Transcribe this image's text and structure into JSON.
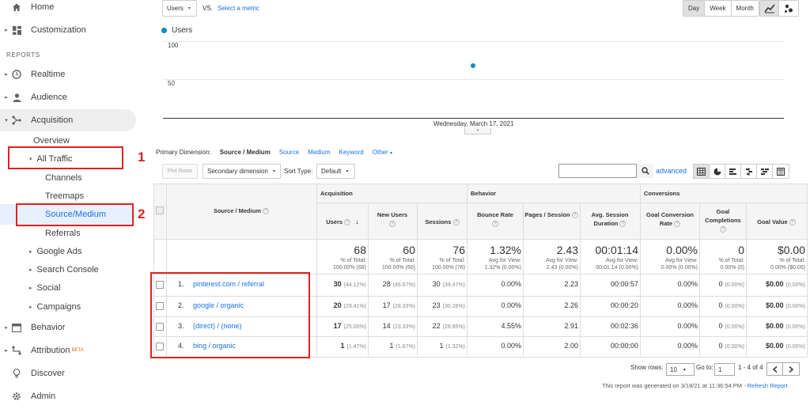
{
  "sidebar": {
    "home": "Home",
    "customization": "Customization",
    "reports_label": "REPORTS",
    "realtime": "Realtime",
    "audience": "Audience",
    "acquisition": "Acquisition",
    "overview": "Overview",
    "all_traffic": "All Traffic",
    "channels": "Channels",
    "treemaps": "Treemaps",
    "source_medium": "Source/Medium",
    "referrals": "Referrals",
    "google_ads": "Google Ads",
    "search_console": "Search Console",
    "social": "Social",
    "campaigns": "Campaigns",
    "behavior": "Behavior",
    "attribution": "Attribution",
    "attribution_badge": "BETA",
    "discover": "Discover",
    "admin": "Admin"
  },
  "annotations": {
    "one": "1",
    "two": "2"
  },
  "toolbar": {
    "metric": "Users",
    "vs": "VS.",
    "select_metric": "Select a metric",
    "day": "Day",
    "week": "Week",
    "month": "Month"
  },
  "chart_data": {
    "type": "scatter",
    "series": [
      {
        "name": "Users",
        "values": [
          68
        ]
      }
    ],
    "x": [
      "Wednesday, March 17, 2021"
    ],
    "yticks": [
      "100",
      "50"
    ],
    "ylim": [
      0,
      100
    ]
  },
  "dimension": {
    "label": "Primary Dimension:",
    "selected": "Source / Medium",
    "options": [
      "Source",
      "Medium",
      "Keyword",
      "Other"
    ]
  },
  "tools": {
    "plot_rows": "Plot Rows",
    "secondary_dimension": "Secondary dimension",
    "sort_type_label": "Sort Type:",
    "sort_type": "Default",
    "advanced": "advanced"
  },
  "table": {
    "dim_header": "Source / Medium",
    "groups": [
      "Acquisition",
      "Behavior",
      "Conversions"
    ],
    "columns": [
      "Users",
      "New Users",
      "Sessions",
      "Bounce Rate",
      "Pages / Session",
      "Avg. Session Duration",
      "Goal Conversion Rate",
      "Goal Completions",
      "Goal Value"
    ],
    "totals": [
      {
        "big": "68",
        "l1": "% of Total:",
        "l2": "100.00% (68)"
      },
      {
        "big": "60",
        "l1": "% of Total:",
        "l2": "100.00% (60)"
      },
      {
        "big": "76",
        "l1": "% of Total:",
        "l2": "100.00% (76)"
      },
      {
        "big": "1.32%",
        "l1": "Avg for View:",
        "l2": "1.32% (0.00%)"
      },
      {
        "big": "2.43",
        "l1": "Avg for View:",
        "l2": "2.43 (0.00%)"
      },
      {
        "big": "00:01:14",
        "l1": "Avg for View:",
        "l2": "00:01:14 (0.00%)"
      },
      {
        "big": "0.00%",
        "l1": "Avg for View:",
        "l2": "0.00% (0.00%)"
      },
      {
        "big": "0",
        "l1": "% of Total:",
        "l2": "0.00% (0)"
      },
      {
        "big": "$0.00",
        "l1": "% of Total:",
        "l2": "0.00% ($0.00)"
      }
    ],
    "rows": [
      {
        "n": "1.",
        "name": "pinterest.com / referral",
        "users": "30",
        "users_pct": "(44.12%)",
        "new": "28",
        "new_pct": "(46.67%)",
        "sess": "30",
        "sess_pct": "(39.47%)",
        "bounce": "0.00%",
        "pages": "2.23",
        "dur": "00:00:57",
        "conv": "0.00%",
        "comp": "0",
        "comp_pct": "(0.00%)",
        "val": "$0.00",
        "val_pct": "(0.00%)"
      },
      {
        "n": "2.",
        "name": "google / organic",
        "users": "20",
        "users_pct": "(29.41%)",
        "new": "17",
        "new_pct": "(28.33%)",
        "sess": "23",
        "sess_pct": "(30.26%)",
        "bounce": "0.00%",
        "pages": "2.26",
        "dur": "00:00:20",
        "conv": "0.00%",
        "comp": "0",
        "comp_pct": "(0.00%)",
        "val": "$0.00",
        "val_pct": "(0.00%)"
      },
      {
        "n": "3.",
        "name": "(direct) / (none)",
        "users": "17",
        "users_pct": "(25.00%)",
        "new": "14",
        "new_pct": "(23.33%)",
        "sess": "22",
        "sess_pct": "(28.95%)",
        "bounce": "4.55%",
        "pages": "2.91",
        "dur": "00:02:36",
        "conv": "0.00%",
        "comp": "0",
        "comp_pct": "(0.00%)",
        "val": "$0.00",
        "val_pct": "(0.00%)"
      },
      {
        "n": "4.",
        "name": "bing / organic",
        "users": "1",
        "users_pct": "(1.47%)",
        "new": "1",
        "new_pct": "(1.67%)",
        "sess": "1",
        "sess_pct": "(1.32%)",
        "bounce": "0.00%",
        "pages": "2.00",
        "dur": "00:00:00",
        "conv": "0.00%",
        "comp": "0",
        "comp_pct": "(0.00%)",
        "val": "$0.00",
        "val_pct": "(0.00%)"
      }
    ]
  },
  "footer": {
    "show_rows": "Show rows:",
    "rows_value": "10",
    "goto": "Go to:",
    "goto_value": "1",
    "range": "1 - 4 of 4",
    "generated": "This report was generated on 3/18/21 at 11:36:54 PM -",
    "refresh": "Refresh Report"
  }
}
